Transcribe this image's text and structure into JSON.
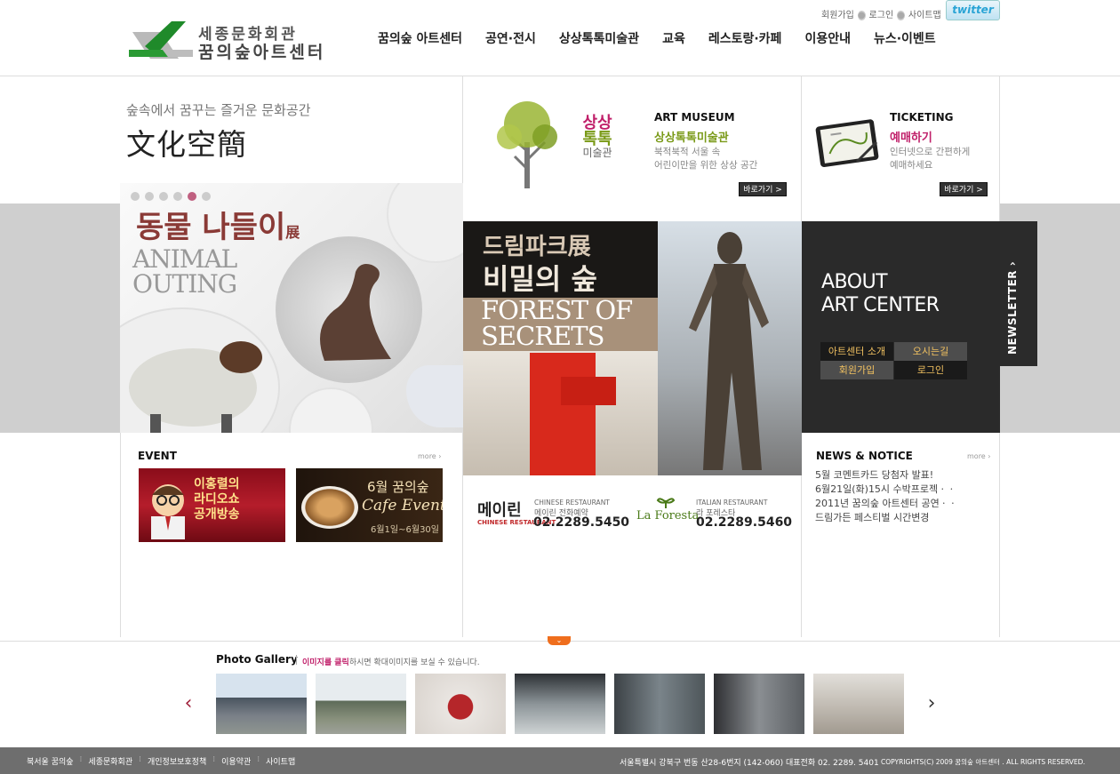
{
  "header": {
    "logo_line1": "세종문화회관",
    "logo_line2": "꿈의숲아트센터",
    "util_links": [
      "회원가입",
      "로그인",
      "사이트맵"
    ],
    "twitter_label": "twitter",
    "nav": [
      "꿈의숲 아트센터",
      "공연·전시",
      "상상톡톡미술관",
      "교육",
      "레스토랑·카페",
      "이용안내",
      "뉴스·이벤트"
    ]
  },
  "tagline": {
    "sub": "숲속에서 꿈꾸는 즐거운 문화공간",
    "main": "文化空簡"
  },
  "museum": {
    "brand_1": "상상",
    "brand_2": "톡톡",
    "brand_3": "미술관",
    "title": "ART MUSEUM",
    "subtitle": "상상톡톡미술관",
    "desc_1": "북적북적 서울 속",
    "desc_2": "어린이만을 위한 상상 공간",
    "go": "바로가기 >"
  },
  "ticketing": {
    "title": "TICKETING",
    "subtitle": "예매하기",
    "desc_1": "인터넷으로 간편하게",
    "desc_2": "예매하세요",
    "go": "바로가기 >"
  },
  "animal_banner": {
    "title_ko": "동물 나들이",
    "title_suffix": "展",
    "title_en": "ANIMAL\nOUTING",
    "slides": 6,
    "active_slide": 4
  },
  "forest_banner": {
    "title_ko_1": "드림파크展",
    "title_ko_2": "비밀의 숲",
    "title_en": "FOREST OF\nSECRETS"
  },
  "about": {
    "title": "ABOUT\nART CENTER",
    "buttons": [
      "아트센터 소개",
      "오시는길",
      "회원가입",
      "로그인"
    ],
    "newsletter": "NEWSLETTER"
  },
  "event": {
    "title": "EVENT",
    "more": "more ›",
    "banner1": "이홍렬의\n라디오쇼\n공개방송",
    "banner2_t1": "6월 꿈의숲",
    "banner2_t2": "Cafe Event!",
    "banner2_t3": "6월1일~6월30일"
  },
  "restaurants": {
    "r1_logo": "메이린",
    "r1_logo_sub": "CHINESE RESTAURANT",
    "r1_type": "CHINESE RESTAURANT",
    "r1_name": "메이린 전화예약",
    "r1_tel": "02.2289.5450",
    "r2_logo": "La Foresta",
    "r2_type": "ITALIAN RESTAURANT",
    "r2_name": "라 포레스타",
    "r2_tel": "02.2289.5460"
  },
  "news": {
    "title": "NEWS & NOTICE",
    "more": "more ›",
    "items": [
      "5월 코멘트카드 당첨자 발표!",
      "6월21일(화)15시 수박프로젝ㆍㆍ",
      "2011년 꿈의숲 아트센터 공연ㆍㆍ",
      "드림가든 페스티벌 시간변경"
    ]
  },
  "gallery": {
    "toggle": "⌄",
    "title": "Photo Gallery",
    "note_highlight": "이미지를 클릭",
    "note_rest": "하시면 확대이미지를 보실 수 있습니다.",
    "prev": "‹",
    "next": "›"
  },
  "footer": {
    "links": [
      "북서울 꿈의숲",
      "세종문화회관",
      "개인정보보호정책",
      "이용약관",
      "사이트맵"
    ],
    "address": "서울특별시 강북구 번동 산28-6번지 (142-060)   대표전화  02. 2289. 5401",
    "copyright": "COPYRIGHTS(C) 2009 꿈의숲 아트센터 . ALL RIGHTS RESERVED."
  },
  "colors": {
    "accent_pink": "#c0206a",
    "accent_green": "#7a9a18",
    "toggle_orange": "#ef6e1d",
    "footer_gray": "#6e6e6e"
  }
}
